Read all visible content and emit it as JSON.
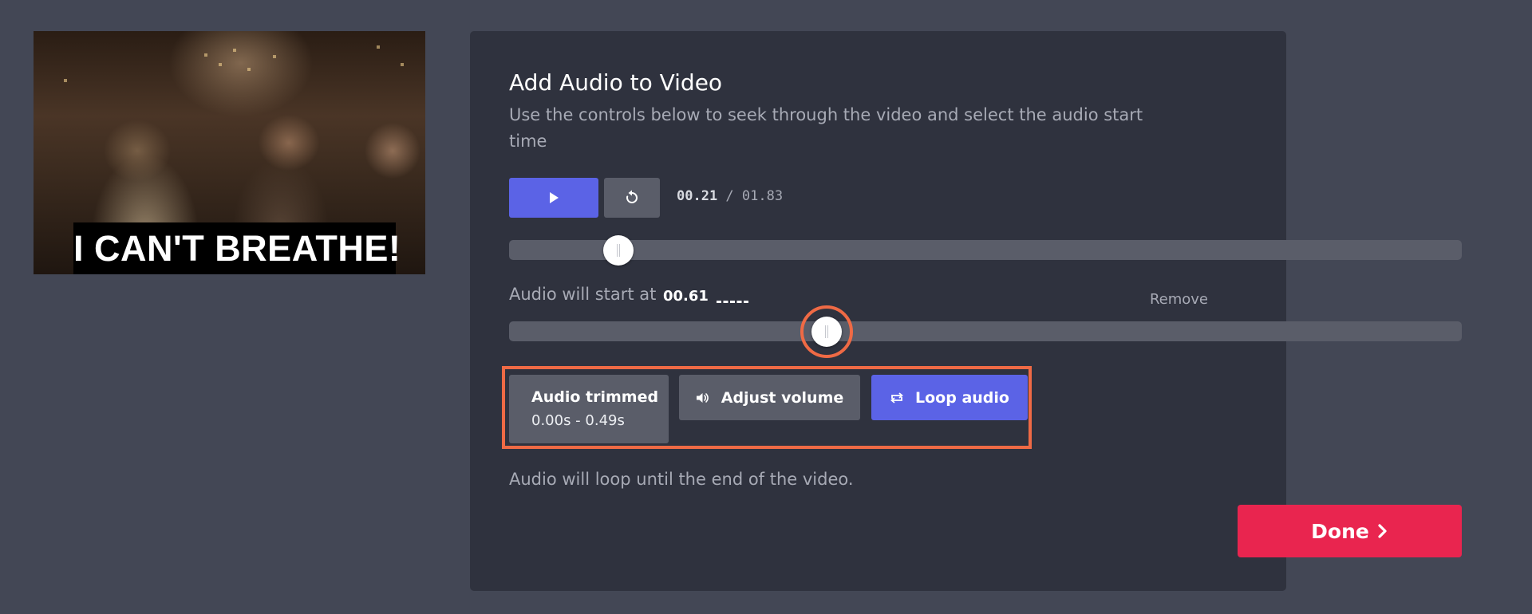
{
  "preview": {
    "caption": "I CAN'T BREATHE!"
  },
  "panel": {
    "title": "Add Audio to Video",
    "description": "Use the controls below to seek through the video and select the audio start time"
  },
  "playback": {
    "play_icon": "play-icon",
    "replay_icon": "replay-icon",
    "current_time": "00.21",
    "separator": " / ",
    "duration": "01.83",
    "video_progress_fraction": 0.115
  },
  "audio": {
    "start_label": "Audio will start at",
    "start_value": "00.61",
    "remove_label": "Remove",
    "start_fraction": 0.333
  },
  "actions": {
    "trimmed_label": "Audio trimmed",
    "trimmed_range": "0.00s - 0.49s",
    "volume_label": "Adjust volume",
    "volume_icon": "speaker-icon",
    "loop_label": "Loop audio",
    "loop_icon": "loop-icon"
  },
  "loop_note": "Audio will loop until the end of the video.",
  "done_label": "Done",
  "colors": {
    "background": "#434755",
    "panel": "#2f323e",
    "primary": "#5b63e6",
    "secondary": "#5a5d69",
    "done": "#e9254f",
    "highlight": "#ef6a45"
  }
}
